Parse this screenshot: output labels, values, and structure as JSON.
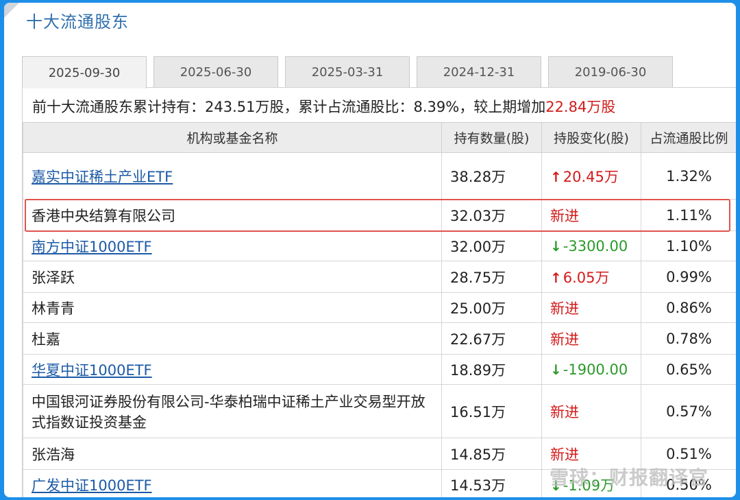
{
  "title": "十大流通股东",
  "tabs": [
    {
      "label": "2025-09-30",
      "active": true
    },
    {
      "label": "2025-06-30",
      "active": false
    },
    {
      "label": "2025-03-31",
      "active": false
    },
    {
      "label": "2024-12-31",
      "active": false
    },
    {
      "label": "2019-06-30",
      "active": false
    }
  ],
  "summary": {
    "prefix": "前十大流通股东累计持有：243.51万股，累计占流通股比：8.39%，较上期增加",
    "increase": "22.84万股"
  },
  "columns": [
    "机构或基金名称",
    "持有数量(股)",
    "持股变化(股)",
    "占流通股比例"
  ],
  "rows": [
    {
      "name": "嘉实中证稀土产业ETF",
      "link": true,
      "holding": "38.28万",
      "change": "20.45万",
      "change_type": "up",
      "ratio": "1.32%"
    },
    {
      "name": "香港中央结算有限公司",
      "link": false,
      "holding": "32.03万",
      "change": "新进",
      "change_type": "new",
      "ratio": "1.11%"
    },
    {
      "name": "南方中证1000ETF",
      "link": true,
      "holding": "32.00万",
      "change": "-3300.00",
      "change_type": "down",
      "ratio": "1.10%"
    },
    {
      "name": "张泽跃",
      "link": false,
      "holding": "28.75万",
      "change": "6.05万",
      "change_type": "up",
      "ratio": "0.99%"
    },
    {
      "name": "林青青",
      "link": false,
      "holding": "25.00万",
      "change": "新进",
      "change_type": "new",
      "ratio": "0.86%"
    },
    {
      "name": "杜嘉",
      "link": false,
      "holding": "22.67万",
      "change": "新进",
      "change_type": "new",
      "ratio": "0.78%"
    },
    {
      "name": "华夏中证1000ETF",
      "link": true,
      "holding": "18.89万",
      "change": "-1900.00",
      "change_type": "down",
      "ratio": "0.65%"
    },
    {
      "name": "中国银河证券股份有限公司-华泰柏瑞中证稀土产业交易型开放式指数证投资基金",
      "link": false,
      "holding": "16.51万",
      "change": "新进",
      "change_type": "new",
      "ratio": "0.57%"
    },
    {
      "name": "张浩海",
      "link": false,
      "holding": "14.85万",
      "change": "新进",
      "change_type": "new",
      "ratio": "0.51%"
    },
    {
      "name": "广发中证1000ETF",
      "link": true,
      "holding": "14.53万",
      "change": "-1.09万",
      "change_type": "down",
      "ratio": "0.50%"
    }
  ],
  "watermark": "雪球：财报翻译官",
  "colors": {
    "accent": "#2f6fad",
    "up": "#d31b1b",
    "down": "#2a9a2a",
    "highlight": "#e0524d"
  }
}
